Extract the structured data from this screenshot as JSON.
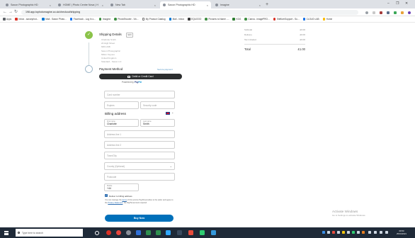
{
  "browser": {
    "tabs": [
      {
        "label": "Saxon Photographic HD",
        "active": false
      },
      {
        "label": "HOME | Photo Centre Nova | H",
        "active": false
      },
      {
        "label": "New Tab",
        "active": false
      },
      {
        "label": "Saxon Photographic HD",
        "active": true
      },
      {
        "label": "Imagine",
        "active": false
      }
    ],
    "url": "198.app.tophotomagine.co.uk/checkout/shipping",
    "bookmarks": [
      "Apps",
      "Inbox - saxonphot...",
      "Mail - Saxon Photo...",
      "Facebook - Log In o...",
      "Imagine",
      "PhotoShooter - Vic...",
      "My Product Catalog",
      "Mail - Inbox",
      "EQUOOO",
      "Pictures to Name -...",
      "KDG",
      "Canva - imagePRO...",
      "ShiftUmSupport - Su...",
      "CLOUD LAB",
      "Home"
    ]
  },
  "checkout": {
    "shipping": {
      "title": "Shipping Details",
      "edit": "Edit",
      "address_lines": [
        "Charlotte Smith",
        "22 High Street",
        "MK9 2AB",
        "Saxon Photographic",
        "Milton Keynes",
        "United Kingdom",
        "Standard - Saxon 1.0"
      ]
    },
    "payment": {
      "title": "Payment Method",
      "secure_link": "Secure payment",
      "card_button": "Debit or Credit Card",
      "powered_by": "Powered by",
      "brand_pay": "Pay",
      "brand_pal": "Pal"
    },
    "card_form": {
      "card_number": "Card number",
      "expires": "Expires",
      "security_code": "Security code"
    },
    "billing": {
      "title": "Billing address",
      "first_name_label": "First name",
      "first_name": "Charlotte",
      "last_name_label": "Last name",
      "last_name": "Smith",
      "address1": "Address line 1",
      "address2": "Address line 2",
      "town": "Town/City",
      "county": "County (Optional)",
      "postcode": "Postcode",
      "phone_label": "Mobile",
      "phone": "+44"
    },
    "deliver_label": "Deliver to billing address",
    "legal_text": {
      "pre": "You can manage the",
      "terms": "terms",
      "mid": "of this service PayPal provides to the seller and agree to the",
      "privacy": "Privacy Statement",
      "post": ". No PayPal account required."
    },
    "buy_button": "Buy Now"
  },
  "summary": {
    "rows": [
      {
        "label": "Subtotal",
        "value": "£0.00"
      },
      {
        "label": "Delivery",
        "value": "£0.00"
      },
      {
        "label": "Tax included",
        "value": "£0.00"
      }
    ],
    "total_label": "Total",
    "total_value": "£1.00"
  },
  "watermark": {
    "title": "Activate Windows",
    "sub": "Go to Settings to activate Windows."
  },
  "taskbar": {
    "search_placeholder": "Type here to search",
    "time": "09:50",
    "date": "25/01/2021"
  },
  "colors": {
    "paypal_blue": "#0070ba",
    "dark_button": "#2c2e2f",
    "step_done": "#8bc34a"
  }
}
